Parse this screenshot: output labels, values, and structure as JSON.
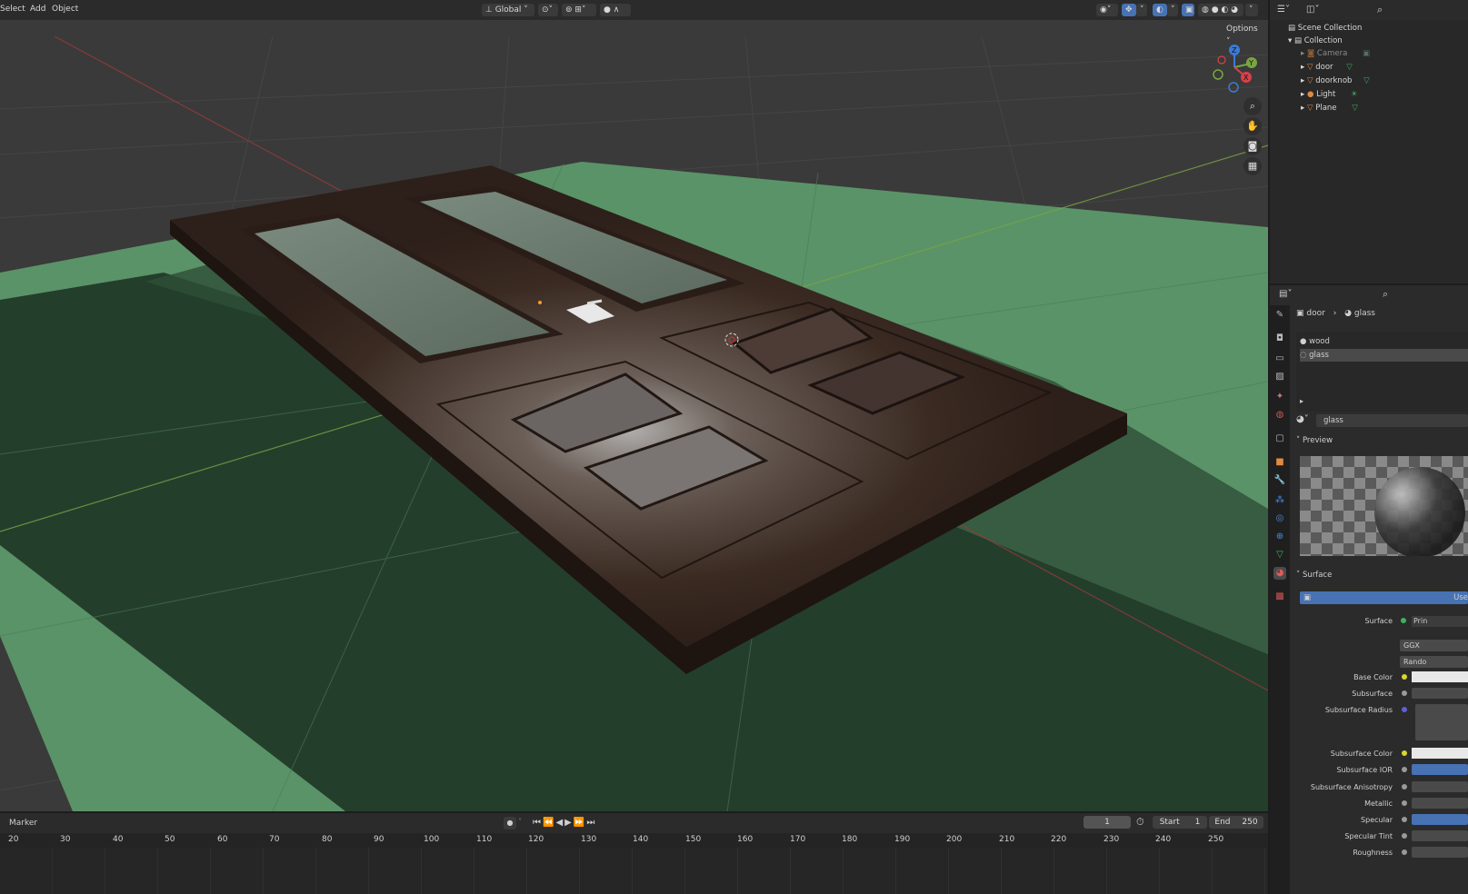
{
  "header": {
    "menus": [
      "Select",
      "Add",
      "Object"
    ],
    "transform_orientation": "Global",
    "options_label": "Options"
  },
  "outliner": {
    "scene_collection": "Scene Collection",
    "collection": "Collection",
    "objects": [
      "Camera",
      "door",
      "doorknob",
      "Light",
      "Plane"
    ]
  },
  "properties": {
    "breadcrumb_object": "door",
    "breadcrumb_material": "glass",
    "material_slots": [
      "wood",
      "glass"
    ],
    "material_name": "glass",
    "preview_label": "Preview",
    "surface_panel_label": "Surface",
    "use_nodes_label": "Use",
    "surface_label": "Surface",
    "surface_value": "Prin",
    "distribution_value": "GGX",
    "subsurface_method_value": "Rando",
    "params": [
      "Base Color",
      "Subsurface",
      "Subsurface Radius",
      "Subsurface Color",
      "Subsurface IOR",
      "Subsurface Anisotropy",
      "Metallic",
      "Specular",
      "Specular Tint",
      "Roughness"
    ]
  },
  "timeline": {
    "marker_label": "Marker",
    "current_frame": "1",
    "start_label": "Start",
    "start_value": "1",
    "end_label": "End",
    "end_value": "250",
    "ticks": [
      "20",
      "30",
      "40",
      "50",
      "60",
      "70",
      "80",
      "90",
      "100",
      "110",
      "120",
      "130",
      "140",
      "150",
      "160",
      "170",
      "180",
      "190",
      "200",
      "210",
      "220",
      "230",
      "240",
      "250"
    ]
  },
  "colors": {
    "accent": "#4772b3",
    "viewport_bg": "#3a3a3a",
    "ground": "#5e9a6c",
    "door": "#3a2a22"
  },
  "icons": [
    "gizmo-axes-icon",
    "zoom-icon",
    "pan-hand-icon",
    "camera-view-icon",
    "grid-icon"
  ]
}
